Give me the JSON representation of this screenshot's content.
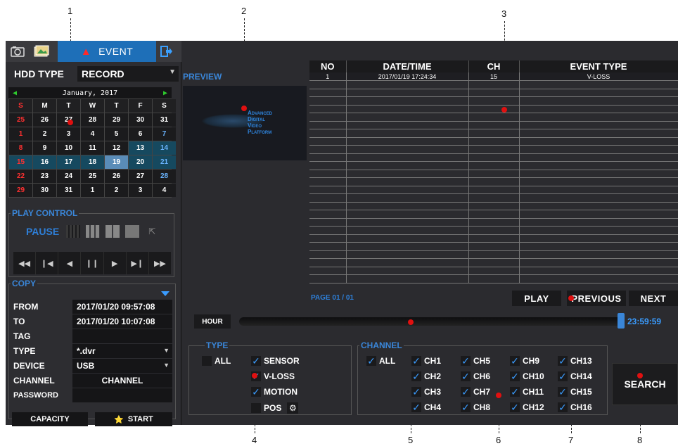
{
  "callouts": [
    "1",
    "2",
    "3",
    "4",
    "5",
    "6",
    "7",
    "8"
  ],
  "topbar": {
    "event_tab": "EVENT",
    "icons": [
      "camera-icon",
      "photo-icon",
      "bell-icon",
      "exit-icon"
    ]
  },
  "hdd": {
    "label": "HDD TYPE",
    "value": "RECORD"
  },
  "calendar": {
    "month_label": "January, 2017",
    "days_of_week": [
      "S",
      "M",
      "T",
      "W",
      "T",
      "F",
      "S"
    ],
    "weeks": [
      [
        "25",
        "26",
        "27",
        "28",
        "29",
        "30",
        "31"
      ],
      [
        "1",
        "2",
        "3",
        "4",
        "5",
        "6",
        "7"
      ],
      [
        "8",
        "9",
        "10",
        "11",
        "12",
        "13",
        "14"
      ],
      [
        "15",
        "16",
        "17",
        "18",
        "19",
        "20",
        "21"
      ],
      [
        "22",
        "23",
        "24",
        "25",
        "26",
        "27",
        "28"
      ],
      [
        "29",
        "30",
        "31",
        "1",
        "2",
        "3",
        "4"
      ]
    ],
    "recorded_days": [
      "13",
      "14",
      "15",
      "16",
      "17",
      "18",
      "20",
      "21"
    ],
    "selected_day": "19"
  },
  "play_control": {
    "legend": "PLAY CONTROL",
    "pause_label": "PAUSE"
  },
  "copy": {
    "legend": "COPY",
    "rows": [
      {
        "label": "FROM",
        "value": "2017/01/20 09:57:08"
      },
      {
        "label": "TO",
        "value": "2017/01/20 10:07:08"
      },
      {
        "label": "TAG",
        "value": ""
      },
      {
        "label": "TYPE",
        "value": "*.dvr"
      },
      {
        "label": "DEVICE",
        "value": "USB"
      },
      {
        "label": "CHANNEL",
        "value": "CHANNEL"
      },
      {
        "label": "PASSWORD",
        "value": ""
      }
    ],
    "capacity_label": "CAPACITY",
    "start_label": "START"
  },
  "preview": {
    "label": "PREVIEW",
    "logo_lines": [
      "Advanced",
      "Digital",
      "Video",
      "Platform"
    ]
  },
  "event_table": {
    "headers": [
      "NO",
      "DATE/TIME",
      "CH",
      "EVENT TYPE"
    ],
    "rows": [
      [
        "1",
        "2017/01/19 17:24:34",
        "15",
        "V-LOSS"
      ]
    ],
    "empty_rows": 25
  },
  "pager": "PAGE 01 / 01",
  "nav": {
    "play": "PLAY",
    "previous": "PREVIOUS",
    "next": "NEXT"
  },
  "timeline": {
    "hour_label": "HOUR",
    "end_time": "23:59:59",
    "position": 0.99
  },
  "type_filter": {
    "legend": "TYPE",
    "all_label": "ALL",
    "items": [
      {
        "label": "SENSOR",
        "checked": true
      },
      {
        "label": "V-LOSS",
        "checked": true
      },
      {
        "label": "MOTION",
        "checked": true
      },
      {
        "label": "POS",
        "checked": false
      }
    ]
  },
  "channel_filter": {
    "legend": "CHANNEL",
    "all_label": "ALL",
    "channels": [
      "CH1",
      "CH2",
      "CH3",
      "CH4",
      "CH5",
      "CH6",
      "CH7",
      "CH8",
      "CH9",
      "CH10",
      "CH11",
      "CH12",
      "CH13",
      "CH14",
      "CH15",
      "CH16"
    ]
  },
  "search_label": "SEARCH",
  "colors": {
    "accent": "#3a86d8",
    "event_tab": "#1e6fb8",
    "sunday": "#ff3030",
    "saturday": "#6ab4ff"
  }
}
